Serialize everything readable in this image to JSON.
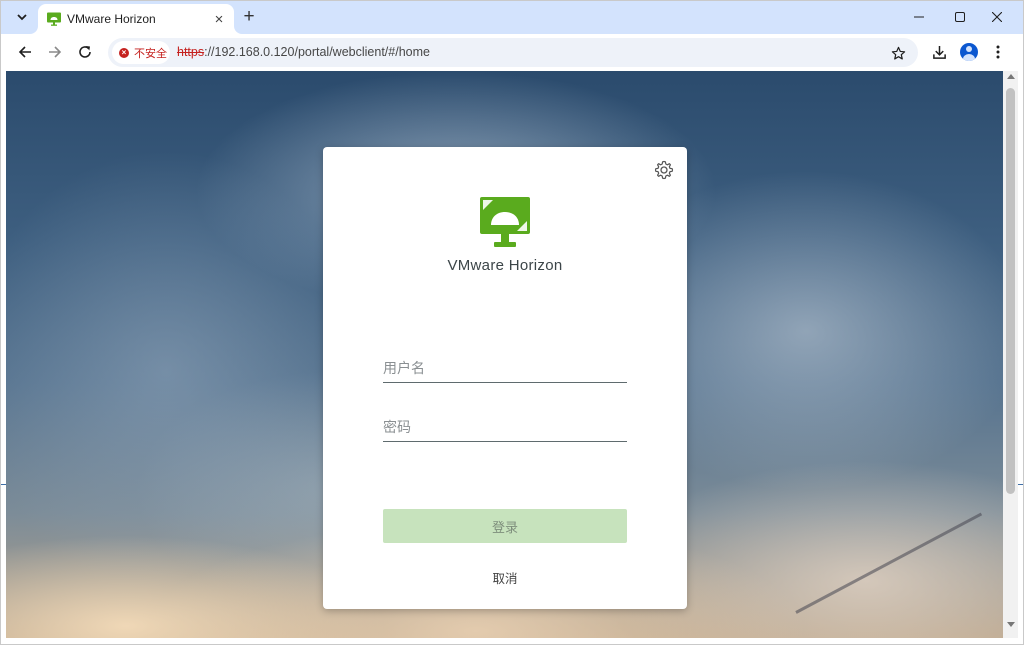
{
  "browser": {
    "tab": {
      "title": "VMware Horizon",
      "favicon": "vmware-horizon-favicon",
      "close_label": "×"
    },
    "new_tab_label": "+",
    "address_bar": {
      "security_label": "不安全",
      "url_scheme": "https",
      "url_rest": "://192.168.0.120/portal/webclient/#/home"
    },
    "colors": {
      "tabstrip": "#d3e3fd",
      "insecure": "#c5221f",
      "accent": "#0b57d0"
    }
  },
  "login": {
    "brand": "VMware Horizon",
    "username_placeholder": "用户名",
    "password_placeholder": "密码",
    "username_value": "",
    "password_value": "",
    "login_label": "登录",
    "cancel_label": "取消",
    "login_enabled": false,
    "colors": {
      "logo_green": "#5aab1e",
      "login_button_disabled": "#c7e3bd"
    }
  },
  "icons": {
    "tab_menu": "chevron-down-icon",
    "back": "arrow-left-icon",
    "forward": "arrow-right-icon",
    "reload": "reload-icon",
    "bookmark": "star-icon",
    "download": "download-icon",
    "profile": "avatar-icon",
    "menu": "kebab-menu-icon",
    "settings": "gear-icon",
    "minimize": "minimize-icon",
    "maximize": "maximize-icon",
    "close": "close-icon"
  }
}
